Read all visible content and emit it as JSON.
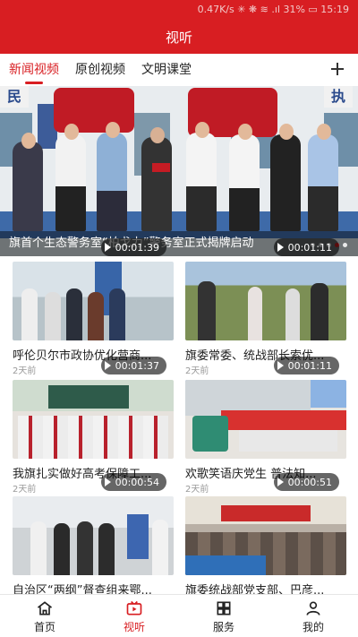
{
  "status": {
    "text": "0.47K/s ✳ ❋ ≋ .ıl 31% ▭ 15:19"
  },
  "header": {
    "title": "视听"
  },
  "tabs": [
    {
      "label": "新闻视频",
      "active": true
    },
    {
      "label": "原创视频",
      "active": false
    },
    {
      "label": "文明课堂",
      "active": false
    }
  ],
  "banner": {
    "caption": "旗首个生态警务室“柏戈力”警务室正式揭牌启动",
    "sign_left": "民",
    "sign_right": "执"
  },
  "videos": [
    {
      "title": "呼伦贝尔市政协优化营商...",
      "duration": "00:01:39",
      "time": "2天前"
    },
    {
      "title": "旗委常委、统战部长索优...",
      "duration": "00:01:11",
      "time": "2天前"
    },
    {
      "title": "我旗扎实做好高考保障工...",
      "duration": "00:01:37",
      "time": "2天前"
    },
    {
      "title": "欢歌笑语庆党生 普法知...",
      "duration": "00:01:11",
      "time": "2天前"
    },
    {
      "title": "自治区“两纲”督查组来鄂...",
      "duration": "00:00:54",
      "time": ""
    },
    {
      "title": "旗委统战部党支部、巴彦...",
      "duration": "00:00:51",
      "time": ""
    }
  ],
  "nav": [
    {
      "label": "首页",
      "icon": "home-icon",
      "active": false
    },
    {
      "label": "视听",
      "icon": "video-icon",
      "active": true
    },
    {
      "label": "服务",
      "icon": "grid-icon",
      "active": false
    },
    {
      "label": "我的",
      "icon": "user-icon",
      "active": false
    }
  ],
  "colors": {
    "brand_red": "#d81e22"
  }
}
